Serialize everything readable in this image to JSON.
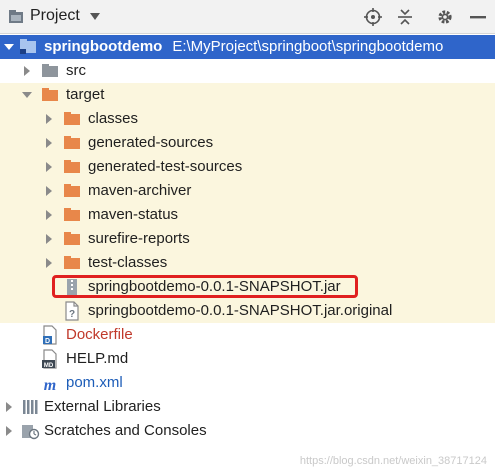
{
  "toolbar": {
    "title": "Project",
    "icons": [
      "project-view-icon",
      "dropdown-arrow-icon",
      "locate-icon",
      "collapse-all-icon",
      "gear-icon",
      "hide-icon"
    ]
  },
  "tree": {
    "root": {
      "name": "springbootdemo",
      "path": "E:\\MyProject\\springboot\\springbootdemo"
    },
    "src": "src",
    "target": "target",
    "target_children": [
      "classes",
      "generated-sources",
      "generated-test-sources",
      "maven-archiver",
      "maven-status",
      "surefire-reports",
      "test-classes"
    ],
    "jar": "springbootdemo-0.0.1-SNAPSHOT.jar",
    "jar_original": "springbootdemo-0.0.1-SNAPSHOT.jar.original",
    "dockerfile": "Dockerfile",
    "help": "HELP.md",
    "pom": "pom.xml",
    "external_libraries": "External Libraries",
    "scratches": "Scratches and Consoles"
  },
  "watermark": "https://blog.csdn.net/weixin_38717124",
  "colors": {
    "selection": "#2f65ca",
    "target_bg": "#fbf6de",
    "highlight_border": "#e02020",
    "folder_orange": "#e8874a",
    "folder_gray": "#8e959c"
  }
}
